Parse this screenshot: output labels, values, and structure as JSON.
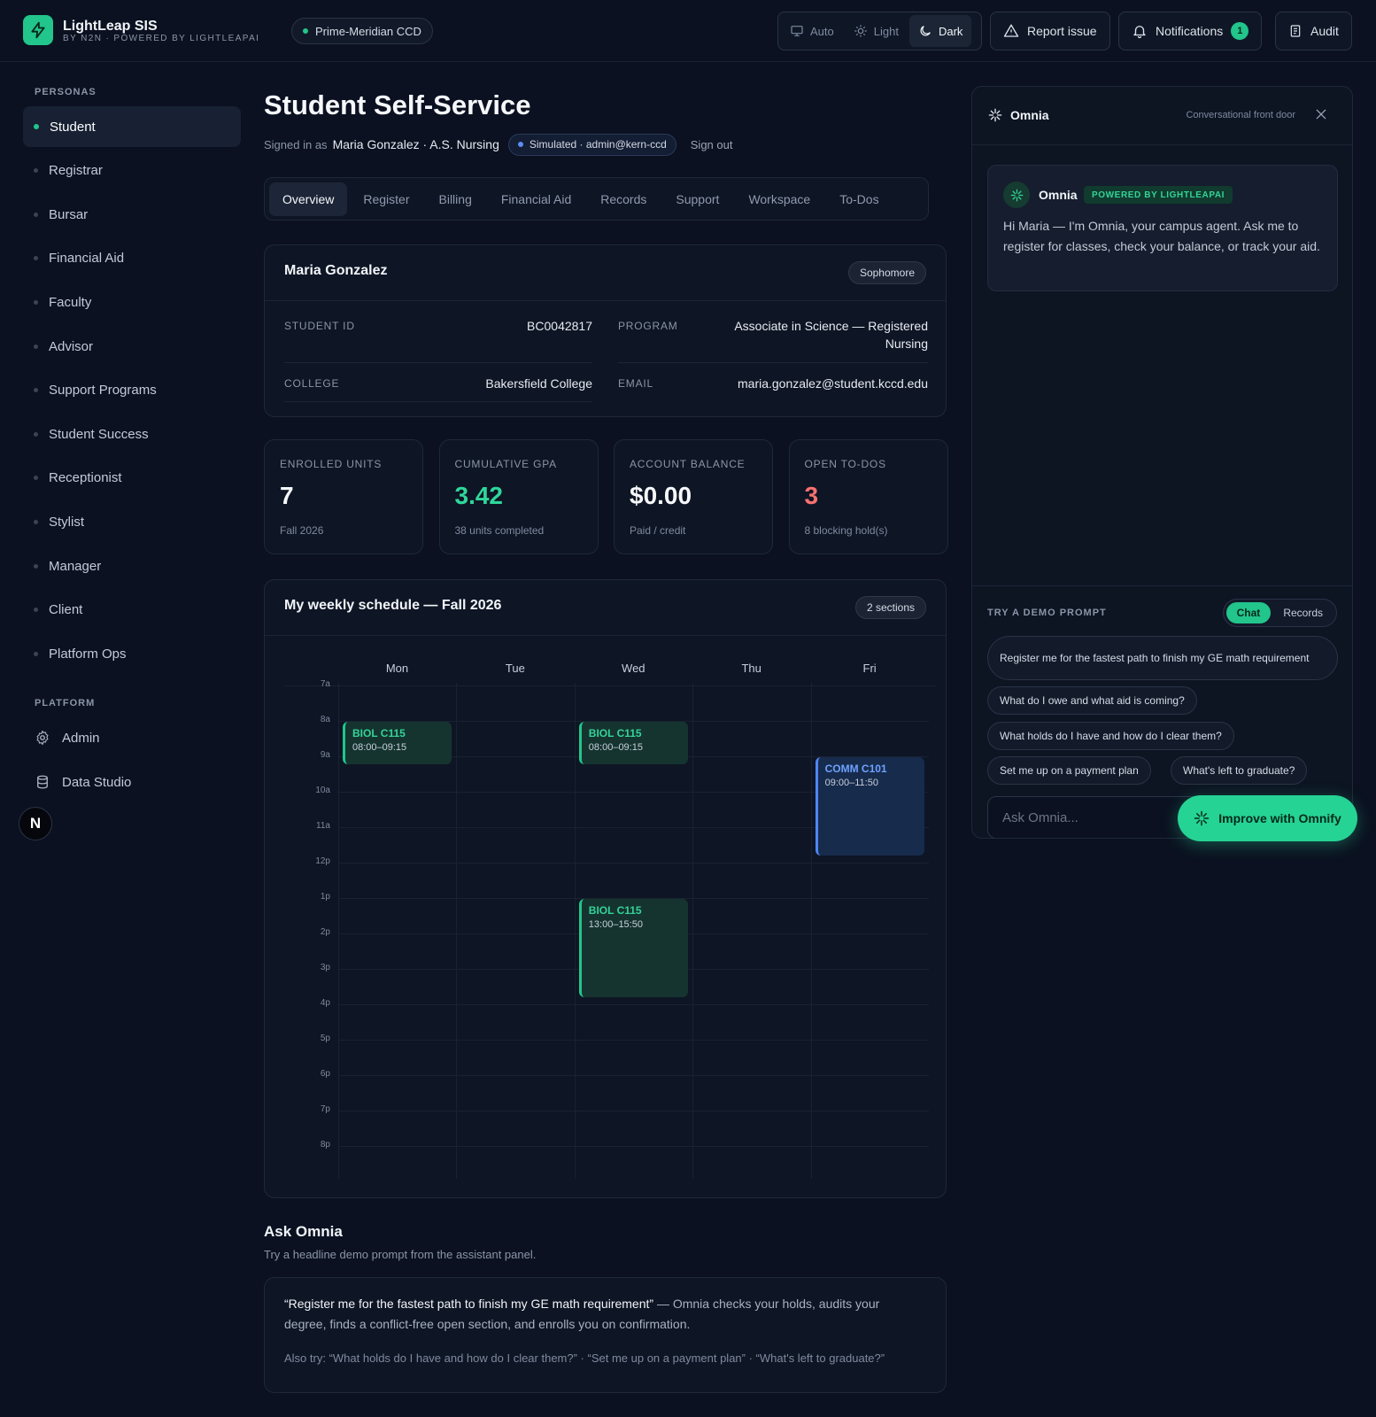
{
  "brand": {
    "name": "LightLeap SIS",
    "tagline": "BY N2N · POWERED BY LIGHTLEAPAI",
    "accent": "#22c58b"
  },
  "district": "Prime-Meridian CCD",
  "theme": {
    "options": [
      "Auto",
      "Light",
      "Dark"
    ],
    "selected": "Dark"
  },
  "topbar": {
    "report_issue": "Report issue",
    "notifications": "Notifications",
    "notification_count": "1",
    "audit": "Audit"
  },
  "sidebar": {
    "personas_label": "PERSONAS",
    "personas": [
      "Student",
      "Registrar",
      "Bursar",
      "Financial Aid",
      "Faculty",
      "Advisor",
      "Support Programs",
      "Student Success",
      "Receptionist",
      "Stylist",
      "Manager",
      "Client",
      "Platform Ops"
    ],
    "active": "Student",
    "platform_label": "PLATFORM",
    "platform": [
      {
        "label": "Admin",
        "icon": "gear-icon"
      },
      {
        "label": "Data Studio",
        "icon": "database-icon"
      }
    ],
    "avatar_letter": "N"
  },
  "page": {
    "title": "Student Self-Service",
    "signed_in_prefix": "Signed in as",
    "signed_in_user": "Maria Gonzalez · A.S. Nursing",
    "simulated": "Simulated · admin@kern-ccd",
    "sign_out": "Sign out"
  },
  "tabs": [
    "Overview",
    "Register",
    "Billing",
    "Financial Aid",
    "Records",
    "Support",
    "Workspace",
    "To-Dos"
  ],
  "active_tab": "Overview",
  "profile": {
    "name": "Maria Gonzalez",
    "level": "Sophomore",
    "fields": {
      "student_id_label": "STUDENT ID",
      "student_id": "BC0042817",
      "program_label": "PROGRAM",
      "program": "Associate in Science — Registered Nursing",
      "college_label": "COLLEGE",
      "college": "Bakersfield College",
      "email_label": "EMAIL",
      "email": "maria.gonzalez@student.kccd.edu"
    }
  },
  "stats": [
    {
      "label": "ENROLLED UNITS",
      "value": "7",
      "sub": "Fall 2026",
      "color": "#f5f7fa"
    },
    {
      "label": "CUMULATIVE GPA",
      "value": "3.42",
      "sub": "38 units completed",
      "color": "#2fd79a"
    },
    {
      "label": "ACCOUNT BALANCE",
      "value": "$0.00",
      "sub": "Paid / credit",
      "color": "#f5f7fa"
    },
    {
      "label": "OPEN TO-DOS",
      "value": "3",
      "sub": "8 blocking hold(s)",
      "color": "#f87171"
    }
  ],
  "schedule": {
    "title": "My weekly schedule — Fall 2026",
    "badge": "2 sections",
    "days": [
      "Mon",
      "Tue",
      "Wed",
      "Thu",
      "Fri"
    ],
    "hours": [
      "7a",
      "8a",
      "9a",
      "10a",
      "11a",
      "12p",
      "1p",
      "2p",
      "3p",
      "4p",
      "5p",
      "6p",
      "7p",
      "8p"
    ],
    "events": [
      {
        "code": "BIOL C115",
        "time": "08:00–09:15",
        "day": "Mon",
        "start": 8.0,
        "end": 9.25,
        "color": "green"
      },
      {
        "code": "BIOL C115",
        "time": "08:00–09:15",
        "day": "Wed",
        "start": 8.0,
        "end": 9.25,
        "color": "green"
      },
      {
        "code": "COMM C101",
        "time": "09:00–11:50",
        "day": "Fri",
        "start": 9.0,
        "end": 11.833,
        "color": "blue"
      },
      {
        "code": "BIOL C115",
        "time": "13:00–15:50",
        "day": "Wed",
        "start": 13.0,
        "end": 15.833,
        "color": "green"
      }
    ]
  },
  "ask": {
    "title": "Ask Omnia",
    "subtitle": "Try a headline demo prompt from the assistant panel.",
    "quote": "“Register me for the fastest path to finish my GE math requirement”",
    "quote_rest": " — Omnia checks your holds, audits your degree, finds a conflict-free open section, and enrolls you on confirmation.",
    "also_try": "Also try: “What holds do I have and how do I clear them?” · “Set me up on a payment plan” · “What's left to graduate?”"
  },
  "panel": {
    "title": "Omnia",
    "subtitle": "Conversational front door",
    "message_name": "Omnia",
    "message_badge": "POWERED BY LIGHTLEAPAI",
    "message": "Hi Maria — I'm Omnia, your campus agent. Ask me to register for classes, check your balance, or track your aid.",
    "demo_label": "TRY A DEMO PROMPT",
    "modes": [
      "Chat",
      "Records"
    ],
    "active_mode": "Chat",
    "prompts": [
      "Register me for the fastest path to finish my GE math requirement",
      "What do I owe and what aid is coming?",
      "What holds do I have and how do I clear them?",
      "Set me up on a payment plan",
      "What's left to graduate?"
    ],
    "input_placeholder": "Ask Omnia..."
  },
  "omnify_button": "Improve with Omnify"
}
